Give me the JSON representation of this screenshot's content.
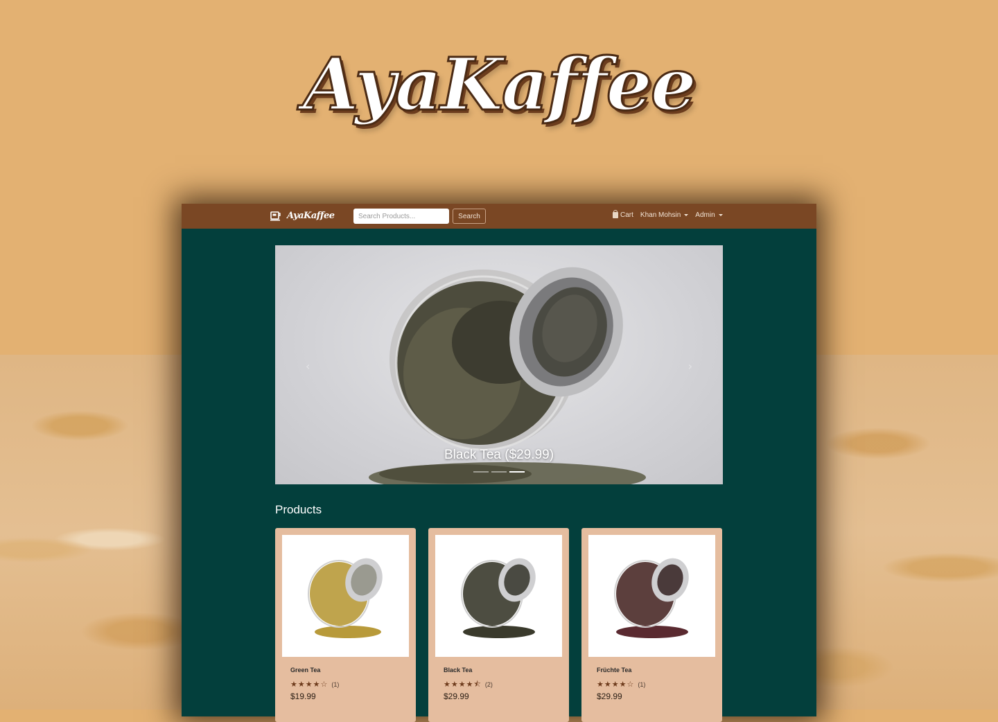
{
  "hero": {
    "title": "AyaKaffee"
  },
  "navbar": {
    "brand": "AyaKaffee",
    "search_placeholder": "Search Products...",
    "search_button": "Search",
    "cart_label": "Cart",
    "user_label": "Khan Mohsin",
    "admin_label": "Admin"
  },
  "carousel": {
    "caption": "Black Tea ($29.99)",
    "slide_count": 3,
    "active_slide": 2
  },
  "products": {
    "heading": "Products",
    "items": [
      {
        "name": "Green Tea",
        "rating": 4,
        "reviews": "(1)",
        "price": "$19.99",
        "tea_color": "#b89a3a"
      },
      {
        "name": "Black Tea",
        "rating": 4.5,
        "reviews": "(2)",
        "price": "$29.99",
        "tea_color": "#3a3a2c"
      },
      {
        "name": "Früchte Tea",
        "rating": 4,
        "reviews": "(1)",
        "price": "$29.99",
        "tea_color": "#5a2a30"
      }
    ]
  },
  "colors": {
    "background": "#e3b172",
    "navbar": "#7a4724",
    "page": "#033f3c",
    "card": "#e5bd9f",
    "star": "#6e3b1c"
  }
}
